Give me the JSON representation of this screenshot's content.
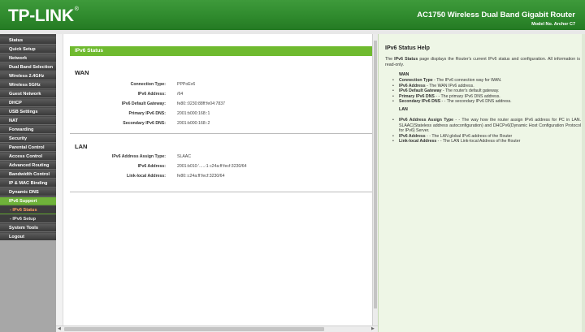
{
  "header": {
    "logo": "TP-LINK",
    "logo_reg": "®",
    "product": "AC1750 Wireless Dual Band Gigabit Router",
    "model": "Model No. Archer C7"
  },
  "sidebar": {
    "items": [
      {
        "label": "Status"
      },
      {
        "label": "Quick Setup"
      },
      {
        "label": "Network"
      },
      {
        "label": "Dual Band Selection"
      },
      {
        "label": "Wireless 2.4GHz"
      },
      {
        "label": "Wireless 5GHz"
      },
      {
        "label": "Guest Network"
      },
      {
        "label": "DHCP"
      },
      {
        "label": "USB Settings"
      },
      {
        "label": "NAT"
      },
      {
        "label": "Forwarding"
      },
      {
        "label": "Security"
      },
      {
        "label": "Parental Control"
      },
      {
        "label": "Access Control"
      },
      {
        "label": "Advanced Routing"
      },
      {
        "label": "Bandwidth Control"
      },
      {
        "label": "IP & MAC Binding"
      },
      {
        "label": "Dynamic DNS"
      },
      {
        "label": "IPv6 Support"
      },
      {
        "label": "- IPv6 Status"
      },
      {
        "label": "- IPv6 Setup"
      },
      {
        "label": "System Tools"
      },
      {
        "label": "Logout"
      }
    ]
  },
  "main": {
    "title": "IPv6 Status",
    "wan": {
      "heading": "WAN",
      "rows": [
        {
          "label": "Connection Type:",
          "value": "PPPoEv6"
        },
        {
          "label": "IPv6 Address:",
          "value": "/64"
        },
        {
          "label": "IPv6 Default Gateway:",
          "value": "fe80::0230:88ff:fe04:7837"
        },
        {
          "label": "Primary IPv6 DNS:",
          "value": "2001:b000:168::1"
        },
        {
          "label": "Secondary IPv6 DNS:",
          "value": "2001:b000:168::2"
        }
      ]
    },
    "lan": {
      "heading": "LAN",
      "rows": [
        {
          "label": "IPv6 Address Assign Type:",
          "value": "SLAAC"
        },
        {
          "label": "IPv6 Address:",
          "value": "2001:b010:ʻ.....:1       c24a:ff:fecf:3230/64"
        },
        {
          "label": "Link-local Address:",
          "value": "fe80::c24a:ff:fecf:3230/64"
        }
      ]
    }
  },
  "help": {
    "title": "IPv6 Status Help",
    "intro_prefix": "The ",
    "intro_term": "IPv6 Status",
    "intro_rest": " page displays the Router's current IPv6 status and configuration. All information is read-only.",
    "wan_heading": "WAN",
    "wan_items": [
      {
        "term": "Connection Type",
        "desc": " - The IPv6 connection way for WAN."
      },
      {
        "term": "IPv6 Address",
        "desc": " - The WAN IPv6 address."
      },
      {
        "term": "IPv6 Default Gateway",
        "desc": " - The router's default gateway."
      },
      {
        "term": "Primary IPv6 DNS",
        "desc": " - - The primary IPv6 DNS address."
      },
      {
        "term": "Secondary IPv6 DNS",
        "desc": " - - The secondary IPv6 DNS address."
      }
    ],
    "lan_heading": "LAN",
    "lan_items": [
      {
        "term": "IPv6 Address Assign Type",
        "desc": " - - The way how the router assign IPv6 address for PC in LAN. SLAAC(Stateless address autoconfiguration) and DHCPv6(Dynamic Host Configuration Protocol for IPv6) Server."
      },
      {
        "term": "IPv6 Address",
        "desc": " - - The LAN global IPv6 address of the Router"
      },
      {
        "term": "Link-local Address",
        "desc": " - - The LAN Link-local Address of the Router"
      }
    ]
  },
  "colors": {
    "brand_green": "#2f8a2d",
    "title_bar_green": "#6fba2f",
    "sidebar_dark": "#4a4a4a",
    "help_bg": "#eef6e6"
  }
}
